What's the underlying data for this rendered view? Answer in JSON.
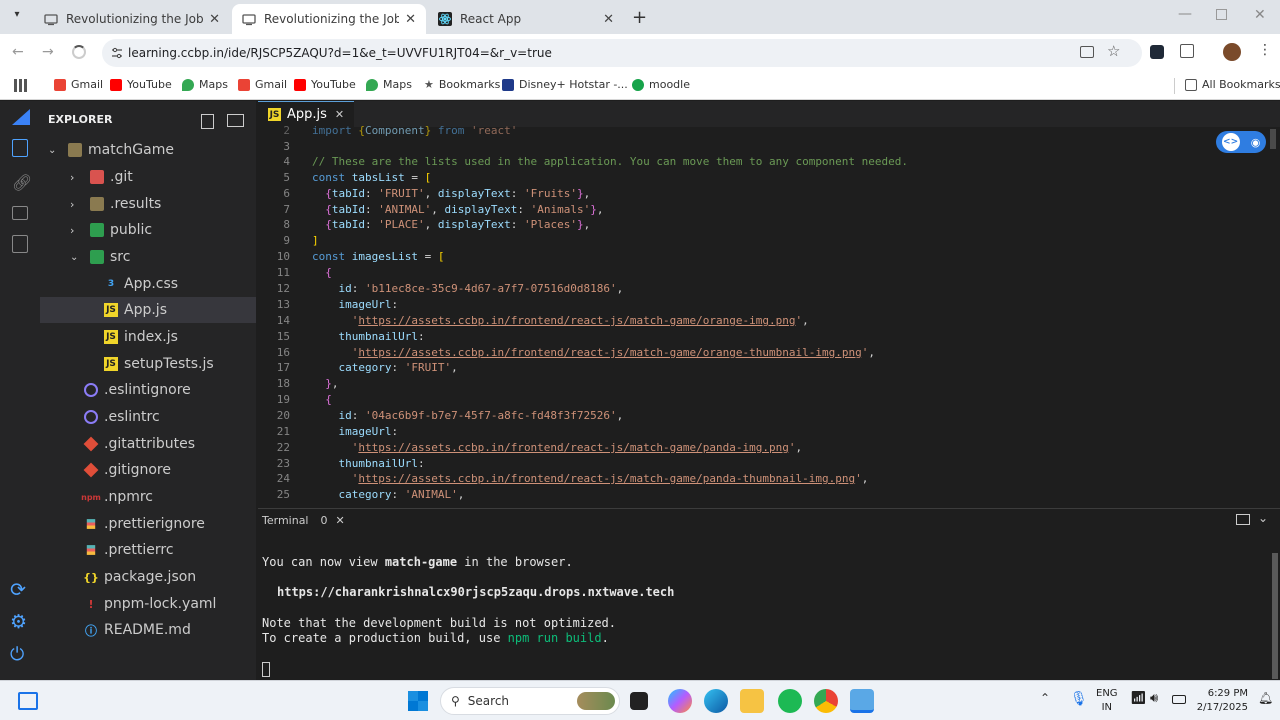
{
  "browser": {
    "tabs": [
      {
        "title": "Revolutionizing the Job Market"
      },
      {
        "title": "Revolutionizing the Job Market"
      },
      {
        "title": "React App"
      }
    ],
    "url": "learning.ccbp.in/ide/RJSCP5ZAQU?d=1&e_t=UVVFU1RJT04=&r_v=true",
    "bookmarks": [
      {
        "label": "Gmail",
        "color": "#ea4335"
      },
      {
        "label": "YouTube",
        "color": "#ff0000"
      },
      {
        "label": "Maps",
        "color": "#34a853"
      },
      {
        "label": "Gmail",
        "color": "#ea4335"
      },
      {
        "label": "YouTube",
        "color": "#ff0000"
      },
      {
        "label": "Maps",
        "color": "#34a853"
      },
      {
        "label": "Bookmarks",
        "color": "#5f6368"
      },
      {
        "label": "Disney+ Hotstar -...",
        "color": "#1f3a8a"
      },
      {
        "label": "moodle",
        "color": "#16a34a"
      }
    ],
    "all_bookmarks": "All Bookmarks"
  },
  "explorer": {
    "title": "EXPLORER",
    "root": "matchGame",
    "items": [
      {
        "label": ".git",
        "icon": "git-folder-icon"
      },
      {
        "label": ".results",
        "icon": "folder-icon"
      },
      {
        "label": "public",
        "icon": "public-folder-icon"
      },
      {
        "label": "src",
        "icon": "src-folder-icon"
      },
      {
        "label": "App.css",
        "icon": "css-icon"
      },
      {
        "label": "App.js",
        "icon": "js-icon"
      },
      {
        "label": "index.js",
        "icon": "js-icon"
      },
      {
        "label": "setupTests.js",
        "icon": "js-icon"
      },
      {
        "label": ".eslintignore",
        "icon": "eslint-icon"
      },
      {
        "label": ".eslintrc",
        "icon": "eslint-icon"
      },
      {
        "label": ".gitattributes",
        "icon": "git-icon"
      },
      {
        "label": ".gitignore",
        "icon": "git-icon"
      },
      {
        "label": ".npmrc",
        "icon": "npm-icon"
      },
      {
        "label": ".prettierignore",
        "icon": "prettier-icon"
      },
      {
        "label": ".prettierrc",
        "icon": "prettier-icon"
      },
      {
        "label": "package.json",
        "icon": "json-icon"
      },
      {
        "label": "pnpm-lock.yaml",
        "icon": "yaml-icon"
      },
      {
        "label": "README.md",
        "icon": "markdown-icon"
      }
    ]
  },
  "editor": {
    "tab": "App.js",
    "lines": [
      {
        "n": "2",
        "text": "import {Component} from 'react'"
      },
      {
        "n": "3",
        "text": ""
      },
      {
        "n": "4",
        "text": "// These are the lists used in the application. You can move them to any component needed."
      },
      {
        "n": "5",
        "text": "const tabsList = ["
      },
      {
        "n": "6",
        "text": "  {tabId: 'FRUIT', displayText: 'Fruits'},"
      },
      {
        "n": "7",
        "text": "  {tabId: 'ANIMAL', displayText: 'Animals'},"
      },
      {
        "n": "8",
        "text": "  {tabId: 'PLACE', displayText: 'Places'},"
      },
      {
        "n": "9",
        "text": "]"
      },
      {
        "n": "10",
        "text": "const imagesList = ["
      },
      {
        "n": "11",
        "text": "  {"
      },
      {
        "n": "12",
        "text": "    id: 'b11ec8ce-35c9-4d67-a7f7-07516d0d8186',"
      },
      {
        "n": "13",
        "text": "    imageUrl:"
      },
      {
        "n": "14",
        "text": "      'https://assets.ccbp.in/frontend/react-js/match-game/orange-img.png',"
      },
      {
        "n": "15",
        "text": "    thumbnailUrl:"
      },
      {
        "n": "16",
        "text": "      'https://assets.ccbp.in/frontend/react-js/match-game/orange-thumbnail-img.png',"
      },
      {
        "n": "17",
        "text": "    category: 'FRUIT',"
      },
      {
        "n": "18",
        "text": "  },"
      },
      {
        "n": "19",
        "text": "  {"
      },
      {
        "n": "20",
        "text": "    id: '04ac6b9f-b7e7-45f7-a8fc-fd48f3f72526',"
      },
      {
        "n": "21",
        "text": "    imageUrl:"
      },
      {
        "n": "22",
        "text": "      'https://assets.ccbp.in/frontend/react-js/match-game/panda-img.png',"
      },
      {
        "n": "23",
        "text": "    thumbnailUrl:"
      },
      {
        "n": "24",
        "text": "      'https://assets.ccbp.in/frontend/react-js/match-game/panda-thumbnail-img.png',"
      },
      {
        "n": "25",
        "text": "    category: 'ANIMAL',"
      }
    ]
  },
  "terminal": {
    "title": "Terminal",
    "count": "0",
    "l1_a": "You can now view ",
    "l1_b": "match-game",
    "l1_c": " in the browser.",
    "url": "https://charankrishnalcx90rjscp5zaqu.drops.nxtwave.tech",
    "l3": "Note that the development build is not optimized.",
    "l4_a": "To create a production build, use ",
    "l4_b": "npm run build",
    "l4_c": "."
  },
  "taskbar": {
    "search": "Search",
    "lang1": "ENG",
    "lang2": "IN",
    "time": "6:29 PM",
    "date": "2/17/2025"
  }
}
